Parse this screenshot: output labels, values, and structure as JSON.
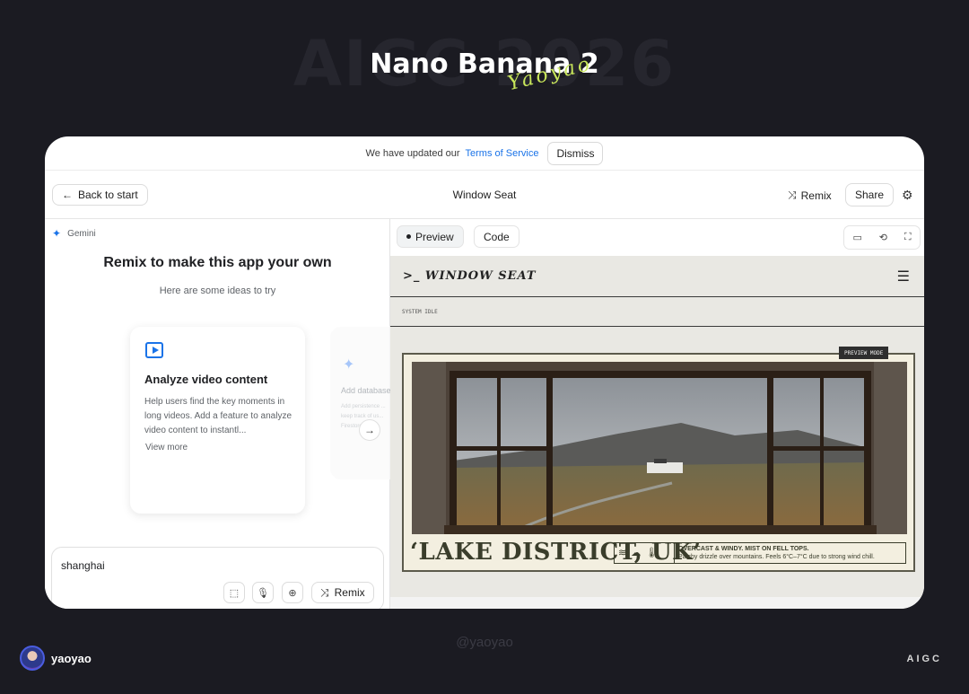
{
  "poster": {
    "watermark": "AIGC 2026",
    "title": "Nano Banana 2",
    "signature": "Yaoyao",
    "author": "yaoyao",
    "handle": "@yaoyao",
    "tag": "AIGC"
  },
  "banner": {
    "prefix": "We have updated our",
    "link": "Terms of Service",
    "dismiss": "Dismiss"
  },
  "header": {
    "back": "Back to start",
    "title": "Window Seat",
    "remix": "Remix",
    "share": "Share"
  },
  "left": {
    "model": "Gemini",
    "heading": "Remix to make this app your own",
    "subheading": "Here are some ideas to try",
    "ideas": [
      {
        "title": "Analyze video content",
        "description": "Help users find the key moments in long videos. Add a feature to analyze video content to instantl...",
        "more": "View more"
      },
      {
        "title": "Add database",
        "description": "Add persistence ... keep track of us... Firestore Da..."
      }
    ],
    "prompt": "shanghai",
    "remix": "Remix"
  },
  "right": {
    "tabs": {
      "preview": "Preview",
      "code": "Code"
    },
    "site": {
      "logo": "WINDOW SEAT",
      "status": "SYSTEM IDLE",
      "badge": "PREVIEW MODE",
      "location": "‘LAKE DISTRICT, UK’",
      "weather_title": "OVERCAST & WINDY. MIST ON FELL TOPS.",
      "weather_detail": "Patchy drizzle over mountains. Feels 6°C–7°C due to strong wind chill."
    }
  },
  "colors": {
    "background": "#1b1b22",
    "accent": "#1a73e8",
    "signature": "#c8e65a",
    "postcard_ink": "#3a3d2b"
  },
  "icons": [
    "arrow-left-icon",
    "remix-icon",
    "settings-icon",
    "gemini-star-icon",
    "video-icon",
    "arrow-right-icon",
    "select-icon",
    "mic-icon",
    "plus-icon",
    "device-icon",
    "refresh-icon",
    "fullscreen-icon",
    "terminal-icon",
    "menu-icon",
    "wind-icon",
    "cloud-icon",
    "thermometer-icon"
  ]
}
